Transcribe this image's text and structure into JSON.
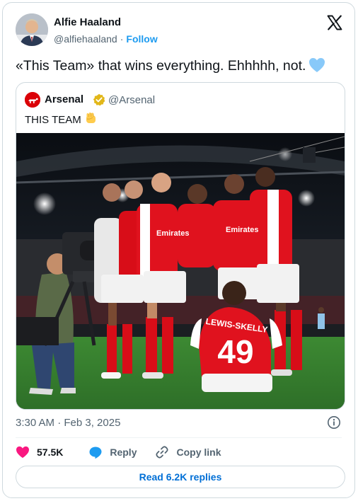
{
  "author": {
    "name": "Alfie Haaland",
    "handle": "@alfiehaaland",
    "separator": "·",
    "follow_label": "Follow"
  },
  "tweet": {
    "text": "«This Team» that wins everything. Ehhhhh, not.",
    "emoji": "light-blue-heart"
  },
  "quoted": {
    "name": "Arsenal",
    "handle": "@Arsenal",
    "verified_badge": "gold-check",
    "text": "THIS TEAM",
    "emoji": "raised-fist",
    "photo": {
      "shirt_text": "Emirates",
      "back_name": "LEWIS-SKELLY",
      "back_number": "49"
    }
  },
  "meta": {
    "timestamp": "3:30 AM · Feb 3, 2025"
  },
  "actions": {
    "likes": "57.5K",
    "reply_label": "Reply",
    "copy_link_label": "Copy link"
  },
  "replies_button": "Read 6.2K replies",
  "colors": {
    "accent": "#1d9bf0",
    "like": "#f91880",
    "arsenal_red": "#db0007"
  }
}
